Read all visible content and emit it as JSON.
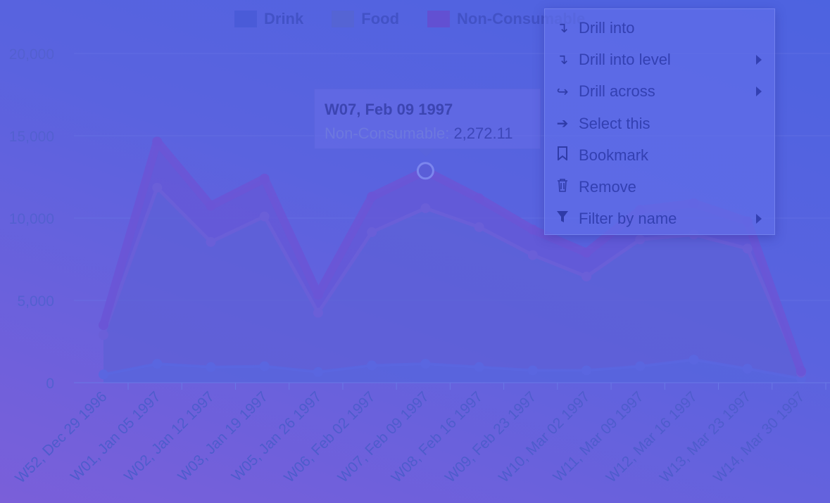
{
  "legend": [
    {
      "label": "Drink",
      "color": "#4a5bd8"
    },
    {
      "label": "Food",
      "color": "#5564d4"
    },
    {
      "label": "Non-Consumable",
      "color": "#6250d2"
    }
  ],
  "tooltip": {
    "title": "W07, Feb 09 1997",
    "series_label": "Non-Consumable:",
    "value_text": "2,272.11"
  },
  "context_menu": {
    "items": [
      {
        "label": "Drill into",
        "icon": "drill-into-icon",
        "glyph": "↴",
        "submenu": false
      },
      {
        "label": "Drill into level",
        "icon": "drill-level-icon",
        "glyph": "↴",
        "submenu": true
      },
      {
        "label": "Drill across",
        "icon": "share-arrow-icon",
        "glyph": "↪",
        "submenu": true
      },
      {
        "label": "Select this",
        "icon": "arrow-right-icon",
        "glyph": "➔",
        "submenu": false
      },
      {
        "label": "Bookmark",
        "icon": "bookmark-icon",
        "glyph": "🔖",
        "submenu": false
      },
      {
        "label": "Remove",
        "icon": "trash-icon",
        "glyph": "🗑",
        "submenu": false
      },
      {
        "label": "Filter by name",
        "icon": "filter-icon",
        "glyph": "▼",
        "submenu": true
      }
    ]
  },
  "chart_data": {
    "type": "area",
    "stacked": true,
    "categories": [
      "W52, Dec 29 1996",
      "W01, Jan 05 1997",
      "W02, Jan 12 1997",
      "W03, Jan 19 1997",
      "W05, Jan 26 1997",
      "W06, Feb 02 1997",
      "W07, Feb 09 1997",
      "W08, Feb 16 1997",
      "W09, Feb 23 1997",
      "W10, Mar 02 1997",
      "W11, Mar 09 1997",
      "W12, Mar 16 1997",
      "W13, Mar 23 1997",
      "W14, Mar 30 1997"
    ],
    "series": [
      {
        "name": "Drink",
        "color": "#5566dd",
        "values": [
          500,
          1150,
          950,
          1000,
          650,
          1050,
          1150,
          950,
          750,
          750,
          1000,
          1400,
          850,
          250
        ]
      },
      {
        "name": "Food",
        "color": "#5a5fd5",
        "values": [
          2400,
          10700,
          7600,
          9100,
          3600,
          8100,
          9450,
          8500,
          7000,
          5700,
          7700,
          7600,
          7300,
          350
        ]
      },
      {
        "name": "Non-Consumable",
        "color": "#6a55d6",
        "values": [
          600,
          2800,
          2200,
          2300,
          1100,
          2150,
          2272.11,
          1750,
          1550,
          1450,
          1800,
          1900,
          1650,
          100
        ]
      }
    ],
    "ylim": [
      0,
      20000
    ],
    "yticks": [
      {
        "value": 0,
        "label": "0"
      },
      {
        "value": 5000,
        "label": "5,000"
      },
      {
        "value": 10000,
        "label": "10,000"
      },
      {
        "value": 15000,
        "label": "15,000"
      },
      {
        "value": 20000,
        "label": "20,000"
      }
    ],
    "highlight_index": 6,
    "grid": true,
    "legend_position": "top"
  }
}
